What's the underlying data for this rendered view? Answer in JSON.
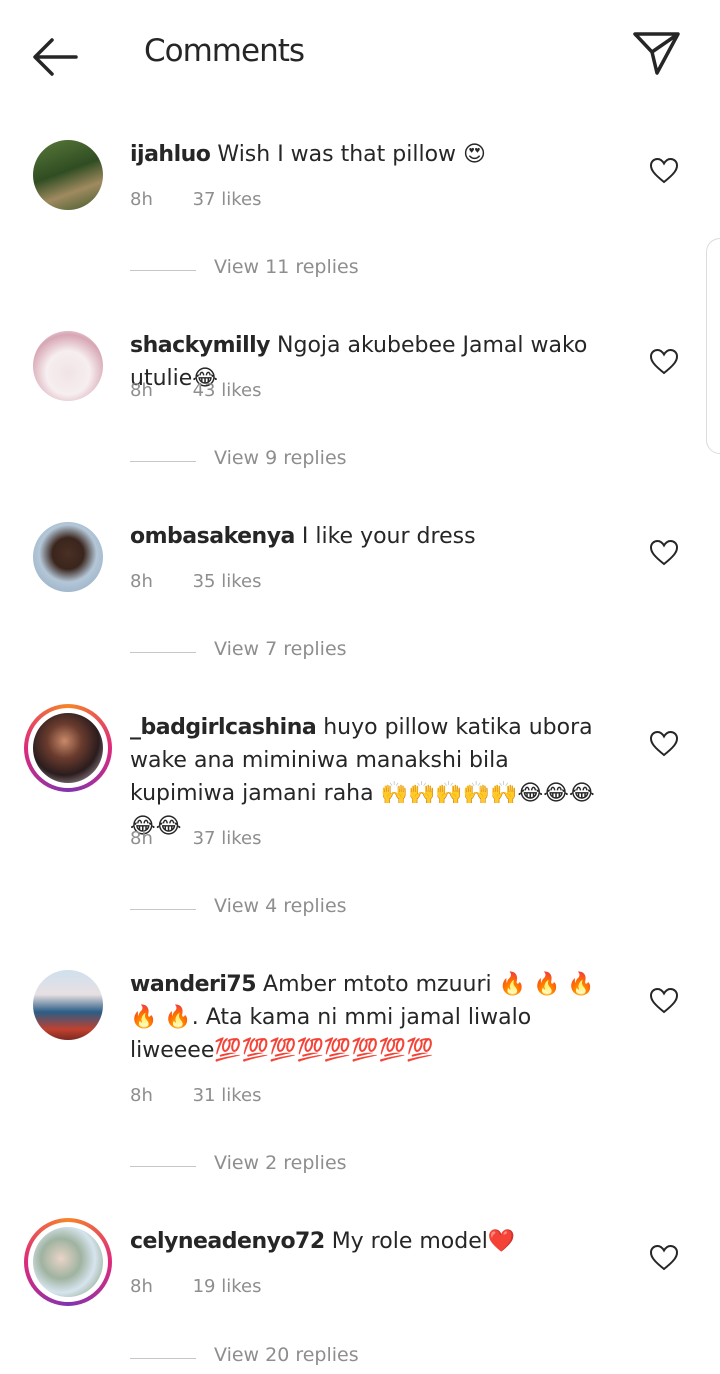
{
  "header": {
    "title": "Comments",
    "back_icon": "arrow-left-icon",
    "send_icon": "paper-plane-icon"
  },
  "comments": [
    {
      "username": "ijahluo",
      "text": "Wish I was that pillow 😍",
      "time": "8h",
      "likes": "37 likes",
      "replies": "View 11 replies"
    },
    {
      "username": "shackymilly",
      "text": "Ngoja akubebee Jamal wako utulie😂",
      "time": "8h",
      "likes": "43 likes",
      "replies": "View 9 replies"
    },
    {
      "username": "ombasakenya",
      "text": "I like your dress",
      "time": "8h",
      "likes": "35 likes",
      "replies": "View 7 replies"
    },
    {
      "username": "_badgirlcashina",
      "text": "huyo pillow katika ubora  wake ana miminiwa manakshi bila kupimiwa jamani raha 🙌🙌🙌🙌🙌😂😂😂😂😂",
      "time": "8h",
      "likes": "37 likes",
      "replies": "View 4 replies"
    },
    {
      "username": "wanderi75",
      "text": "Amber mtoto mzuuri 🔥 🔥 🔥 🔥 🔥. Ata kama ni mmi jamal liwalo liweeee💯💯💯💯💯💯💯💯",
      "time": "8h",
      "likes": "31 likes",
      "replies": "View 2 replies"
    },
    {
      "username": "celyneadenyo72",
      "text": "My role model❤️",
      "time": "8h",
      "likes": "19 likes",
      "replies": "View 20 replies"
    }
  ],
  "colors": {
    "text": "#262626",
    "secondary": "#8e8e8e",
    "story_ring_start": "#f58529",
    "story_ring_end": "#dd2a7b"
  }
}
